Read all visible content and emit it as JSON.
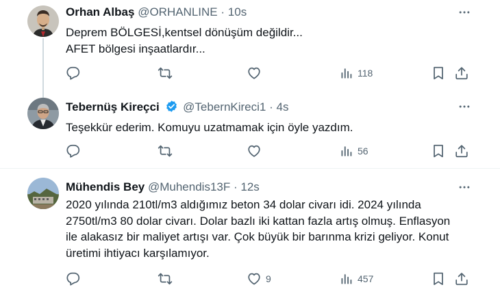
{
  "tweets": [
    {
      "author": "Orhan Albaş",
      "handle": "@ORHANLINE",
      "separator": "·",
      "time": "10s",
      "lines": [
        "Deprem BÖLGESİ,kentsel dönüşüm değildir...",
        "AFET bölgesi inşaatlardır..."
      ],
      "verified": false,
      "actions": {
        "reply": "",
        "retweet": "",
        "like": "",
        "views": "118"
      }
    },
    {
      "author": "Tebernüş Kireçci",
      "handle": "@TebernKireci1",
      "separator": "·",
      "time": "4s",
      "lines": [
        "Teşekkür ederim. Komuyu uzatmamak için öyle yazdım."
      ],
      "verified": true,
      "actions": {
        "reply": "",
        "retweet": "",
        "like": "",
        "views": "56"
      }
    },
    {
      "author": "Mühendis Bey",
      "handle": "@Muhendis13F",
      "separator": "·",
      "time": "12s",
      "lines": [
        "2020 yılında 210tl/m3 aldığımız beton 34 dolar civarı idi. 2024 yılında",
        "2750tl/m3 80 dolar civarı. Dolar bazlı iki kattan fazla artış olmuş. Enflasyon",
        "ile alakasız bir maliyet artışı var. Çok büyük bir barınma krizi geliyor. Konut",
        "üretimi ihtiyacı karşılamıyor."
      ],
      "verified": false,
      "actions": {
        "reply": "",
        "retweet": "",
        "like": "9",
        "views": "457"
      }
    }
  ],
  "icons": {
    "more": "more-icon",
    "reply": "reply-icon",
    "retweet": "retweet-icon",
    "like": "like-icon",
    "views": "views-icon",
    "bookmark": "bookmark-icon",
    "share": "share-icon",
    "verified": "verified-badge-icon"
  },
  "colors": {
    "text": "#0f1419",
    "secondary": "#536471",
    "verified": "#1d9bf0",
    "divider": "#eff3f4",
    "thread_line": "#cfd9de"
  }
}
